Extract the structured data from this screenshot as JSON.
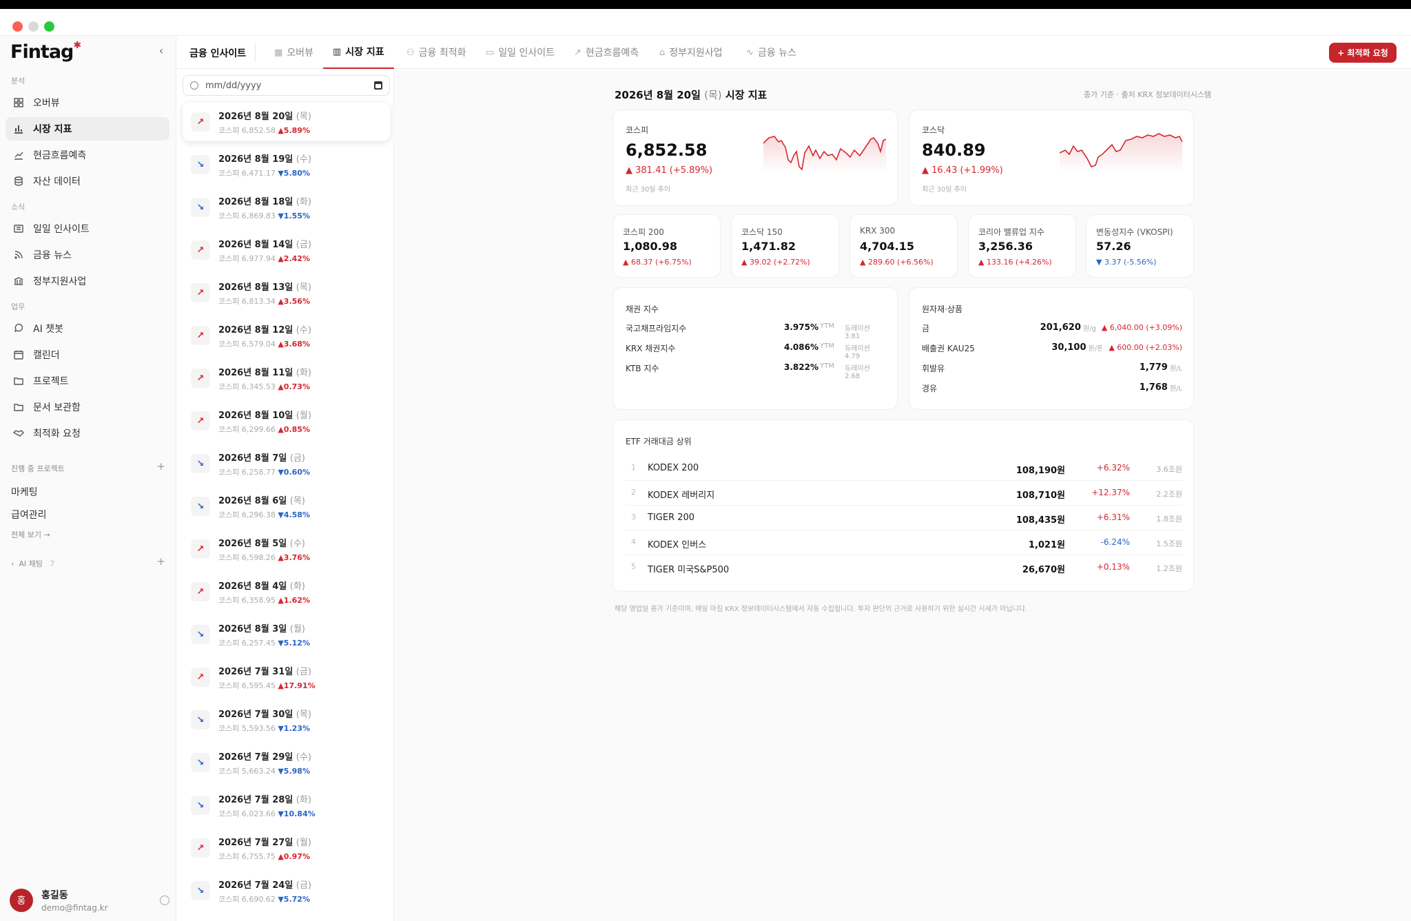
{
  "sidebar": {
    "logo": "Fintag",
    "sections": {
      "analysis": "분석",
      "news": "소식",
      "work": "업무"
    },
    "items": [
      {
        "label": "오버뷰"
      },
      {
        "label": "시장 지표"
      },
      {
        "label": "현금흐름예측"
      },
      {
        "label": "자산 데이터"
      },
      {
        "label": "일일 인사이트"
      },
      {
        "label": "금융 뉴스"
      },
      {
        "label": "정부지원사업"
      },
      {
        "label": "AI 챗봇"
      },
      {
        "label": "캘린더"
      },
      {
        "label": "프로젝트"
      },
      {
        "label": "문서 보관함"
      },
      {
        "label": "최적화 요청"
      }
    ],
    "projects_label": "진행 중 프로젝트",
    "projects": [
      "마케팅",
      "급여관리"
    ],
    "see_all": "전체 보기 →",
    "ai_chat": "AI 채팅",
    "ai_chat_count": "7",
    "user": {
      "initial": "홍",
      "name": "홍길동",
      "email": "demo@fintag.kr"
    }
  },
  "header": {
    "title": "금융 인사이트",
    "tabs": [
      {
        "label": "오버뷰"
      },
      {
        "label": "시장 지표"
      },
      {
        "label": "금융 최적화"
      },
      {
        "label": "일일 인사이트"
      },
      {
        "label": "현금흐름예측"
      },
      {
        "label": "정부지원사업"
      },
      {
        "label": "금융 뉴스"
      }
    ],
    "cta": "+ 최적화 요청"
  },
  "date_list": {
    "placeholder": "mm/dd/yyyy",
    "items": [
      {
        "date": "2026년 8월 20일",
        "dow": "(목)",
        "kospi": "코스피 6,852.58",
        "change": "▲5.89%",
        "dir": "up"
      },
      {
        "date": "2026년 8월 19일",
        "dow": "(수)",
        "kospi": "코스피 6,471.17",
        "change": "▼5.80%",
        "dir": "down"
      },
      {
        "date": "2026년 8월 18일",
        "dow": "(화)",
        "kospi": "코스피 6,869.83",
        "change": "▼1.55%",
        "dir": "down"
      },
      {
        "date": "2026년 8월 14일",
        "dow": "(금)",
        "kospi": "코스피 6,977.94",
        "change": "▲2.42%",
        "dir": "up"
      },
      {
        "date": "2026년 8월 13일",
        "dow": "(목)",
        "kospi": "코스피 6,813.34",
        "change": "▲3.56%",
        "dir": "up"
      },
      {
        "date": "2026년 8월 12일",
        "dow": "(수)",
        "kospi": "코스피 6,579.04",
        "change": "▲3.68%",
        "dir": "up"
      },
      {
        "date": "2026년 8월 11일",
        "dow": "(화)",
        "kospi": "코스피 6,345.53",
        "change": "▲0.73%",
        "dir": "up"
      },
      {
        "date": "2026년 8월 10일",
        "dow": "(월)",
        "kospi": "코스피 6,299.66",
        "change": "▲0.85%",
        "dir": "up"
      },
      {
        "date": "2026년 8월 7일",
        "dow": "(금)",
        "kospi": "코스피 6,258.77",
        "change": "▼0.60%",
        "dir": "down"
      },
      {
        "date": "2026년 8월 6일",
        "dow": "(목)",
        "kospi": "코스피 6,296.38",
        "change": "▼4.58%",
        "dir": "down"
      },
      {
        "date": "2026년 8월 5일",
        "dow": "(수)",
        "kospi": "코스피 6,598.26",
        "change": "▲3.76%",
        "dir": "up"
      },
      {
        "date": "2026년 8월 4일",
        "dow": "(화)",
        "kospi": "코스피 6,358.95",
        "change": "▲1.62%",
        "dir": "up"
      },
      {
        "date": "2026년 8월 3일",
        "dow": "(월)",
        "kospi": "코스피 6,257.45",
        "change": "▼5.12%",
        "dir": "down"
      },
      {
        "date": "2026년 7월 31일",
        "dow": "(금)",
        "kospi": "코스피 6,595.45",
        "change": "▲17.91%",
        "dir": "up"
      },
      {
        "date": "2026년 7월 30일",
        "dow": "(목)",
        "kospi": "코스피 5,593.56",
        "change": "▼1.23%",
        "dir": "down"
      },
      {
        "date": "2026년 7월 29일",
        "dow": "(수)",
        "kospi": "코스피 5,663.24",
        "change": "▼5.98%",
        "dir": "down"
      },
      {
        "date": "2026년 7월 28일",
        "dow": "(화)",
        "kospi": "코스피 6,023.66",
        "change": "▼10.84%",
        "dir": "down"
      },
      {
        "date": "2026년 7월 27일",
        "dow": "(월)",
        "kospi": "코스피 6,755.75",
        "change": "▲0.97%",
        "dir": "up"
      },
      {
        "date": "2026년 7월 24일",
        "dow": "(금)",
        "kospi": "코스피 6,690.62",
        "change": "▼5.72%",
        "dir": "down"
      }
    ]
  },
  "main": {
    "title_date": "2026년 8월 20일",
    "title_dow": "(목)",
    "title_label": "시장 지표",
    "source": "종가 기준 · 출처 KRX 정보데이터시스템",
    "big_cards": [
      {
        "label": "코스피",
        "value": "6,852.58",
        "change": "▲ 381.41 (+5.89%)",
        "note": "최근 30일 추이"
      },
      {
        "label": "코스닥",
        "value": "840.89",
        "change": "▲ 16.43 (+1.99%)",
        "note": "최근 30일 추이"
      }
    ],
    "small_cards": [
      {
        "label": "코스피 200",
        "value": "1,080.98",
        "change": "▲ 68.37 (+6.75%)",
        "dir": "up"
      },
      {
        "label": "코스닥 150",
        "value": "1,471.82",
        "change": "▲ 39.02 (+2.72%)",
        "dir": "up"
      },
      {
        "label": "KRX 300",
        "value": "4,704.15",
        "change": "▲ 289.60 (+6.56%)",
        "dir": "up"
      },
      {
        "label": "코리아 밸류업 지수",
        "value": "3,256.36",
        "change": "▲ 133.16 (+4.26%)",
        "dir": "up"
      },
      {
        "label": "변동성지수 (VKOSPI)",
        "value": "57.26",
        "change": "▼ 3.37 (-5.56%)",
        "dir": "down"
      }
    ],
    "bonds": {
      "title": "채권 지수",
      "rows": [
        {
          "name": "국고채프라임지수",
          "value": "3.975%",
          "ytm": "YTM",
          "duration": "듀레이션 3.81"
        },
        {
          "name": "KRX 채권지수",
          "value": "4.086%",
          "ytm": "YTM",
          "duration": "듀레이션 4.79"
        },
        {
          "name": "KTB 지수",
          "value": "3.822%",
          "ytm": "YTM",
          "duration": "듀레이션 2.68"
        }
      ]
    },
    "commodities": {
      "title": "원자재·상품",
      "rows": [
        {
          "name": "금",
          "value": "201,620",
          "unit": "원/g",
          "change": "▲ 6,040.00 (+3.09%)"
        },
        {
          "name": "배출권 KAU25",
          "value": "30,100",
          "unit": "원/톤",
          "change": "▲ 600.00 (+2.03%)"
        },
        {
          "name": "휘발유",
          "value": "1,779",
          "unit": "원/L",
          "change": ""
        },
        {
          "name": "경유",
          "value": "1,768",
          "unit": "원/L",
          "change": ""
        }
      ]
    },
    "etf": {
      "title": "ETF 거래대금 상위",
      "rows": [
        {
          "rank": "1",
          "name": "KODEX 200",
          "price": "108,190원",
          "change": "+6.32%",
          "dir": "up",
          "volume": "3.6조원"
        },
        {
          "rank": "2",
          "name": "KODEX 레버리지",
          "price": "108,710원",
          "change": "+12.37%",
          "dir": "up",
          "volume": "2.2조원"
        },
        {
          "rank": "3",
          "name": "TIGER 200",
          "price": "108,435원",
          "change": "+6.31%",
          "dir": "up",
          "volume": "1.8조원"
        },
        {
          "rank": "4",
          "name": "KODEX 인버스",
          "price": "1,021원",
          "change": "-6.24%",
          "dir": "down",
          "volume": "1.5조원"
        },
        {
          "rank": "5",
          "name": "TIGER 미국S&P500",
          "price": "26,670원",
          "change": "+0.13%",
          "dir": "up",
          "volume": "1.2조원"
        }
      ]
    },
    "footnote": "해당 영업일 종가 기준이며, 매일 아침 KRX 정보데이터시스템에서 자동 수집됩니다. 투자 판단의 근거로 사용하기 위한 실시간 시세가 아닙니다."
  },
  "colors": {
    "accent": "#c8242c",
    "up": "#d6262f",
    "down": "#2a64c6"
  }
}
